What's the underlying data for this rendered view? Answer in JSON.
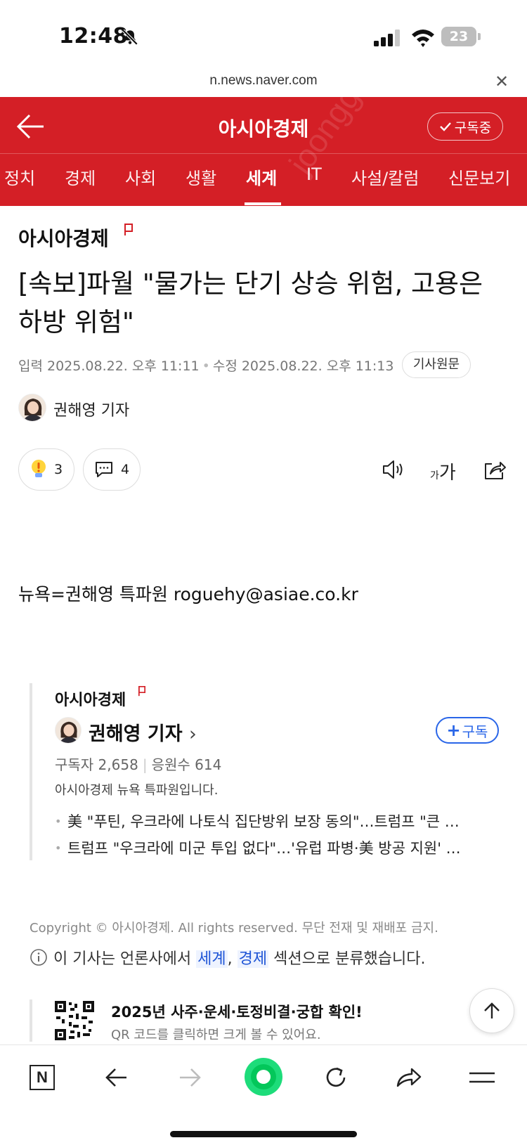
{
  "status_bar": {
    "time": "12:48",
    "battery": "23"
  },
  "browser": {
    "url": "n.news.naver.com"
  },
  "header": {
    "title": "아시아경제",
    "subscribe_label": "구독중",
    "watermark": "joonggonara",
    "tabs": [
      {
        "label": "정치"
      },
      {
        "label": "경제"
      },
      {
        "label": "사회"
      },
      {
        "label": "생활"
      },
      {
        "label": "세계"
      },
      {
        "label": "IT"
      },
      {
        "label": "사설/칼럼"
      },
      {
        "label": "신문보기"
      }
    ],
    "active_tab": "세계"
  },
  "article": {
    "press": "아시아경제",
    "headline": "[속보]파월 \"물가는 단기 상승 위험, 고용은 하방 위험\"",
    "input_date": "입력 2025.08.22. 오후 11:11",
    "modified_date": "수정 2025.08.22. 오후 11:13",
    "original_label": "기사원문",
    "author": "권해영 기자",
    "reaction_count": "3",
    "comment_count": "4",
    "font_size_label_small": "가",
    "font_size_label_large": "가",
    "byline": "뉴욕=권해영 특파원 roguehy@asiae.co.kr"
  },
  "reporter_card": {
    "press": "아시아경제",
    "name": "권해영 기자",
    "chevron": "›",
    "subscribe_label": "구독",
    "subscribers": "구독자 2,658",
    "supporters": "응원수 614",
    "description": "아시아경제 뉴욕 특파원입니다.",
    "articles": [
      "美 \"푸틴, 우크라에 나토식 집단방위 보장 동의\"…트럼프 \"큰 …",
      "트럼프 \"우크라에 미군 투입 없다\"…'유럽 파병·美 방공 지원' …"
    ]
  },
  "footer": {
    "copyright": "Copyright © 아시아경제. All rights reserved. 무단 전재 및 재배포 금지.",
    "section_prefix": "이 기사는 언론사에서",
    "section_1": "세계",
    "section_sep": ",",
    "section_2": "경제",
    "section_suffix": "섹션으로 분류했습니다."
  },
  "promo": {
    "title": "2025년 사주·운세·토정비결·궁합 확인!",
    "subtitle": "QR 코드를 클릭하면 크게 볼 수 있어요."
  },
  "bottom_nav": {
    "home_label": "N"
  },
  "colors": {
    "brand_red": "#d41f26",
    "link_blue": "#2a66e8",
    "naver_green": "#03c75a"
  }
}
